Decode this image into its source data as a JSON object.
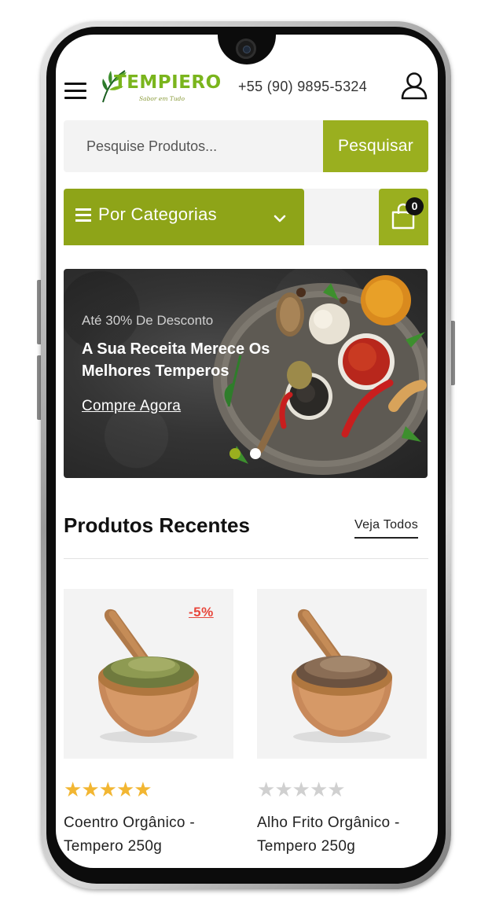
{
  "header": {
    "logo_text": "TEMPIERO",
    "logo_tagline": "Sabor em Tudo",
    "phone": "+55 (90) 9895-5324"
  },
  "search": {
    "placeholder": "Pesquise Produtos...",
    "button_label": "Pesquisar"
  },
  "categories": {
    "label": "Por Categorias"
  },
  "cart": {
    "count": "0"
  },
  "hero": {
    "eyebrow": "Até 30% De Desconto",
    "title": "A Sua Receita Merece Os Melhores Temperos",
    "cta": "Compre Agora",
    "slides": 2,
    "active_slide": 1
  },
  "section": {
    "title": "Produtos Recentes",
    "see_all": "Veja Todos"
  },
  "products": [
    {
      "name": "Coentro Orgânico - Tempero 250g",
      "discount": "-5%",
      "rating": 5,
      "max_rating": 5
    },
    {
      "name": "Alho Frito Orgânico - Tempero 250g",
      "rating": 0,
      "max_rating": 5
    }
  ],
  "colors": {
    "accent": "#9aaf1f",
    "accent_dark": "#8ea418",
    "logo_green": "#7ab51d",
    "discount_red": "#e8463b",
    "star": "#f2b632"
  }
}
